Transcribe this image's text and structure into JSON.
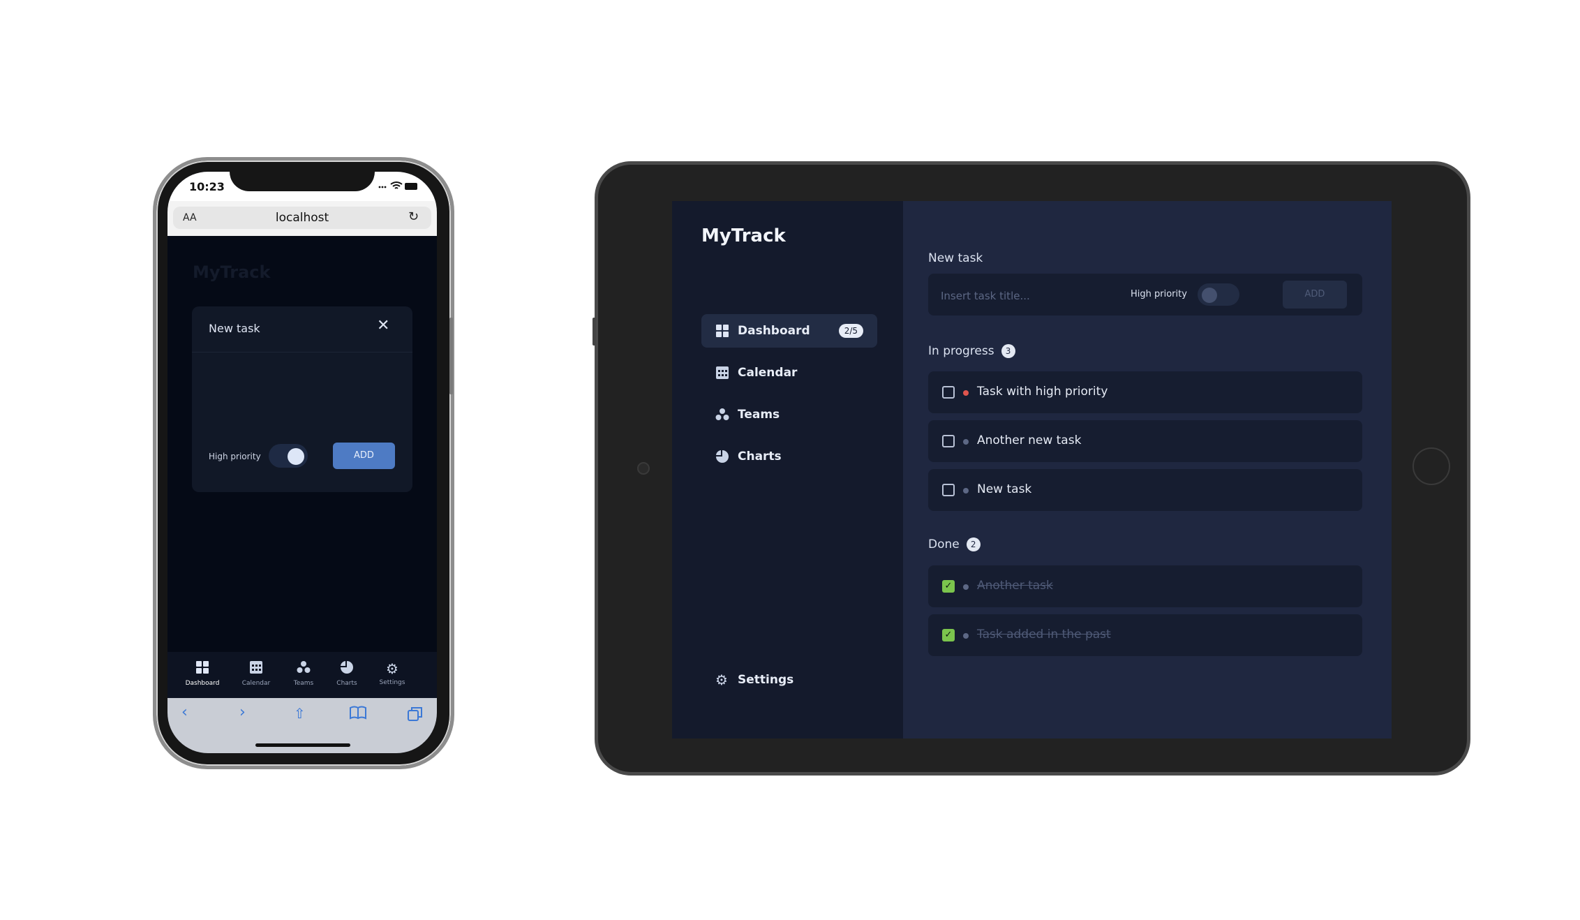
{
  "phone": {
    "status": {
      "time": "10:23"
    },
    "browser": {
      "aa_label": "AA",
      "host": "localhost"
    },
    "brand": "MyTrack",
    "modal": {
      "title": "New task",
      "high_priority_label": "High priority",
      "high_priority_on": true,
      "add_label": "ADD"
    },
    "tabs": [
      {
        "label": "Dashboard",
        "icon": "grid-icon",
        "active": true
      },
      {
        "label": "Calendar",
        "icon": "calendar-icon",
        "active": false
      },
      {
        "label": "Teams",
        "icon": "teams-icon",
        "active": false
      },
      {
        "label": "Charts",
        "icon": "pie-chart-icon",
        "active": false
      },
      {
        "label": "Settings",
        "icon": "gear-icon",
        "active": false
      }
    ]
  },
  "tablet": {
    "brand": "MyTrack",
    "nav": [
      {
        "label": "Dashboard",
        "icon": "grid-icon",
        "badge": "2/5",
        "active": true
      },
      {
        "label": "Calendar",
        "icon": "calendar-icon"
      },
      {
        "label": "Teams",
        "icon": "teams-icon"
      },
      {
        "label": "Charts",
        "icon": "pie-chart-icon"
      }
    ],
    "settings_label": "Settings",
    "new_task": {
      "section_label": "New task",
      "placeholder": "Insert task title...",
      "high_priority_label": "High priority",
      "high_priority_on": false,
      "add_label": "ADD"
    },
    "in_progress": {
      "label": "In progress",
      "count": "3",
      "tasks": [
        {
          "title": "Task with high priority",
          "priority": "high"
        },
        {
          "title": "Another new task",
          "priority": "normal"
        },
        {
          "title": "New task",
          "priority": "normal"
        }
      ]
    },
    "done": {
      "label": "Done",
      "count": "2",
      "tasks": [
        {
          "title": "Another task"
        },
        {
          "title": "Task added in the past"
        }
      ]
    }
  },
  "colors": {
    "accent_blue": "#4e7bc4",
    "high_priority_dot": "#e0554e",
    "normal_dot": "#5d6885",
    "done_check": "#7bc44d"
  }
}
